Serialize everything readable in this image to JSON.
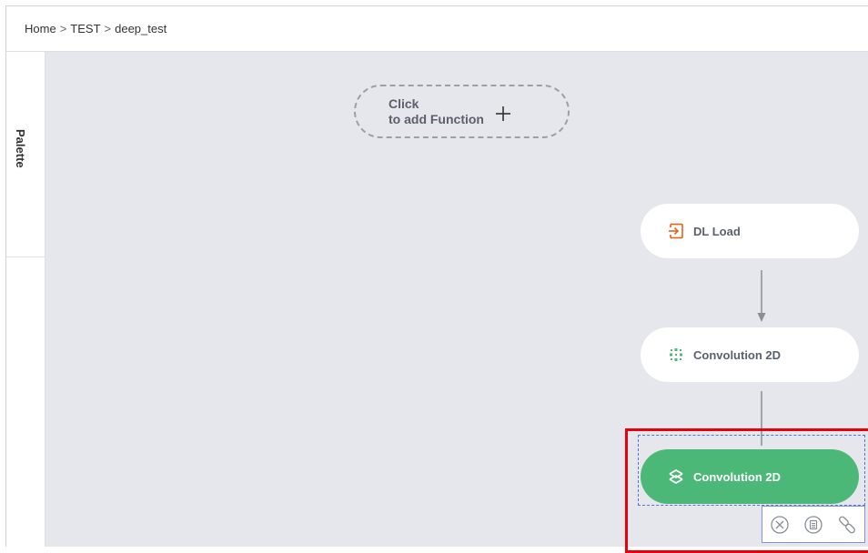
{
  "breadcrumb": {
    "items": [
      "Home",
      "TEST",
      "deep_test"
    ],
    "separator": ">"
  },
  "palette": {
    "label": "Palette"
  },
  "add_function": {
    "line1": "Click",
    "line2": "to add Function",
    "icon": "plus-icon"
  },
  "nodes": [
    {
      "label": "DL Load",
      "icon": "load-icon",
      "icon_color": "#e0641a",
      "selected": false
    },
    {
      "label": "Convolution 2D",
      "icon": "convolution-icon",
      "icon_color": "#4cb878",
      "selected": false
    },
    {
      "label": "Convolution 2D",
      "icon": "convolution-icon",
      "icon_color": "#ffffff",
      "selected": true
    }
  ],
  "node_toolbar": {
    "buttons": [
      "delete-icon",
      "copy-icon",
      "link-icon"
    ]
  },
  "colors": {
    "canvas_bg": "#e5e7ec",
    "selected_node": "#4cb878",
    "highlight": "#e8000b",
    "selection_dash": "#5a6fd8"
  }
}
